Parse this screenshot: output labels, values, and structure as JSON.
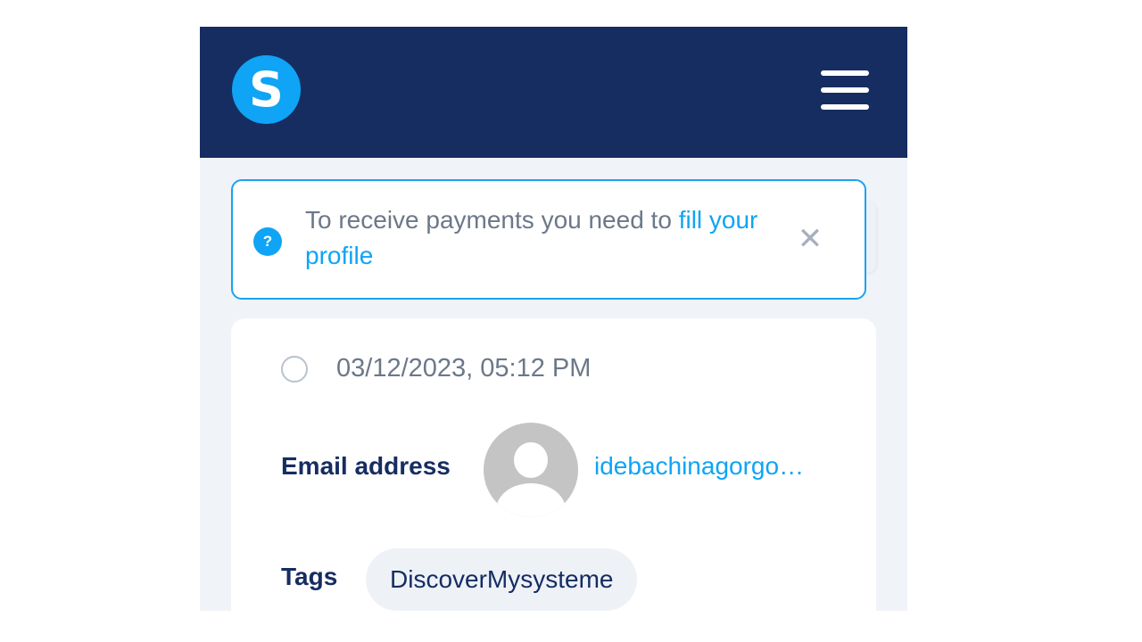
{
  "header": {
    "logo_letter": "S",
    "menu_icon": "hamburger-menu-icon",
    "brand_color": "#0fa4f5",
    "bar_color": "#162d62"
  },
  "alert": {
    "icon": "help-circle-icon",
    "text": "To receive payments you need to ",
    "link_text": "fill your profile",
    "close_icon": "close-icon",
    "close_symbol": "✕"
  },
  "record": {
    "date": "03/12/2023, 05:12 PM",
    "email_label": "Email address",
    "email_value": "idebachinagorgoroyaloe@gmail.com",
    "avatar_icon": "default-avatar-icon",
    "tags_label": "Tags",
    "tags": [
      "DiscoverMysysteme"
    ]
  }
}
